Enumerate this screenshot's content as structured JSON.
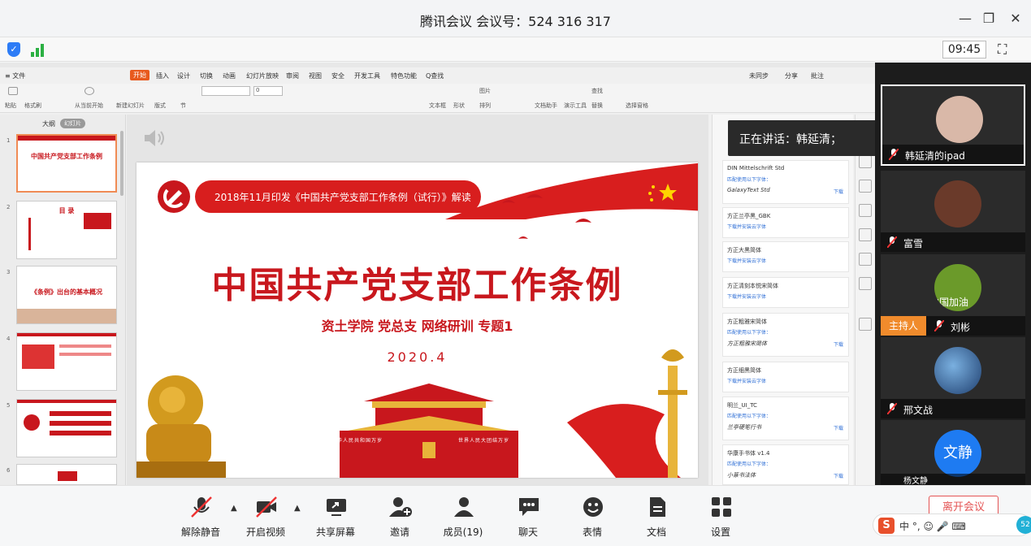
{
  "window": {
    "title": "腾讯会议 会议号：524 316 317",
    "minimize": "—",
    "restore": "❐",
    "close": "✕"
  },
  "status": {
    "time": "09:45",
    "shield": "✓"
  },
  "wps": {
    "menu": [
      "≡ 文件",
      "开始",
      "插入",
      "设计",
      "切换",
      "动画",
      "幻灯片放映",
      "审阅",
      "视图",
      "安全",
      "开发工具",
      "特色功能",
      "Q查找"
    ],
    "active_menu": "开始",
    "menu_right": [
      "未同步",
      "分享",
      "批注"
    ],
    "ribbon": [
      "粘贴",
      "格式刷",
      "从当前开始",
      "新建幻灯片",
      "版式",
      "节",
      "文本框",
      "形状",
      "图片",
      "排列",
      "文档助手",
      "演示工具",
      "替换",
      "选择窗格",
      "查找"
    ],
    "font_size": "0",
    "thumbs_tabs": [
      "大纲",
      "幻灯片"
    ],
    "thumbnails": [
      {
        "num": "1",
        "title": "中国共产党支部工作条例"
      },
      {
        "num": "2",
        "title": "目 录"
      },
      {
        "num": "3",
        "title": "《条例》出台的基本概况"
      },
      {
        "num": "4",
        "title": ""
      },
      {
        "num": "5",
        "title": ""
      },
      {
        "num": "6",
        "title": ""
      }
    ]
  },
  "slide": {
    "banner": "2018年11月印发《中国共产党支部工作条例（试行）》解读",
    "title": "中国共产党支部工作条例",
    "subtitle": "资土学院 党总支  网络研训  专题1",
    "date": "2020.4",
    "gate_left": "中华人民共和国万岁",
    "gate_right": "世界人民大团结万岁"
  },
  "fonts_panel": [
    {
      "name": "DIN Mittelschrift Std",
      "sub": "匹配使用以下字体：",
      "sample": "GalaxyText Std",
      "dl": "下载"
    },
    {
      "name": "方正兰亭黑_GBK",
      "sub": "下载并安装云字体",
      "sample": "",
      "dl": ""
    },
    {
      "name": "方正大黑简体",
      "sub": "下载并安装云字体",
      "sample": "",
      "dl": ""
    },
    {
      "name": "方正清刻本悦宋简体",
      "sub": "下载并安装云字体",
      "sample": "",
      "dl": ""
    },
    {
      "name": "方正粗雅宋简体",
      "sub": "匹配使用以下字体：",
      "sample": "方正粗雅宋简体",
      "dl": "下载"
    },
    {
      "name": "方正细黑简体",
      "sub": "下载并安装云字体",
      "sample": "",
      "dl": ""
    },
    {
      "name": "明兰_UI_TC",
      "sub": "匹配使用以下字体：",
      "sample": "兰亭硬笔行书",
      "dl": "下载"
    },
    {
      "name": "华康手书体 v1.4",
      "sub": "匹配使用以下字体：",
      "sample": "小篆书法体",
      "dl": "下载"
    }
  ],
  "speaking": {
    "label": "正在讲话：韩延清；"
  },
  "participants": [
    {
      "name": "韩延清的ipad",
      "active": true,
      "host": false,
      "avatar": "#d9b8a8"
    },
    {
      "name": "富雪",
      "active": false,
      "host": false,
      "avatar": "#6a3a2a"
    },
    {
      "name": "刘彬",
      "active": false,
      "host": true,
      "avatar": "#6b9a2a"
    },
    {
      "name": "邢文战",
      "active": false,
      "host": false,
      "avatar": "#1e3e6e"
    },
    {
      "name": "杨文静",
      "active": false,
      "host": false,
      "avatar": "#1e7bf2"
    }
  ],
  "host_label": "主持人",
  "avatar_text_3": "中国加油",
  "avatar_text_5": "文静",
  "toolbar": {
    "mute": "解除静音",
    "video": "开启视频",
    "share": "共享屏幕",
    "invite": "邀请",
    "members": "成员(19)",
    "chat": "聊天",
    "emoji": "表情",
    "docs": "文档",
    "settings": "设置",
    "leave": "离开会议"
  },
  "ime": {
    "logo": "S",
    "text": "中 °, ☺ 🎤 ⌨",
    "badge": "52"
  },
  "colors": {
    "party_red": "#c8171d",
    "accent_orange": "#f08b2c",
    "leave_red": "#e45454"
  }
}
